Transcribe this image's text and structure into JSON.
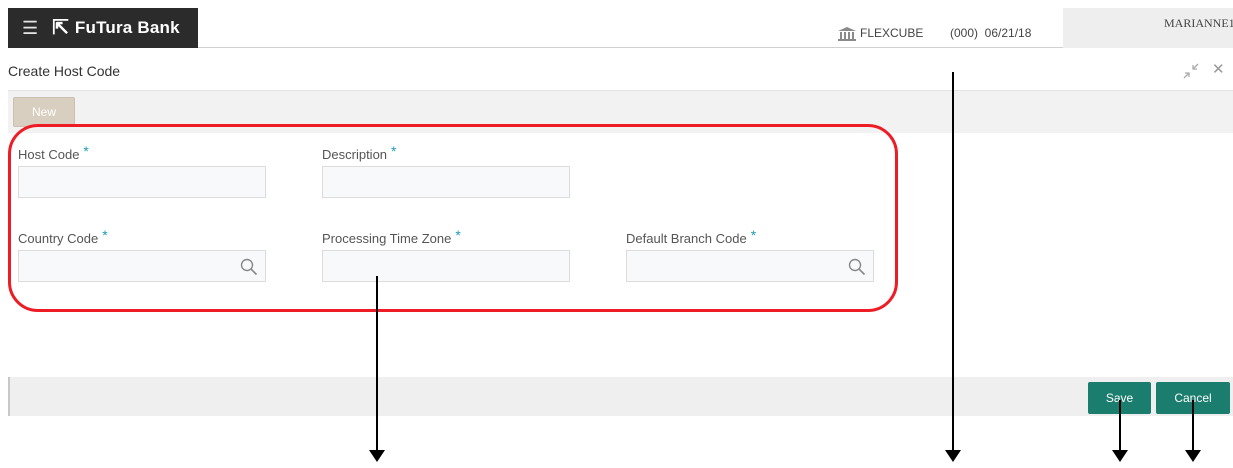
{
  "header": {
    "menu_icon": "hamburger-icon",
    "brand_logo": "bank-logo",
    "brand_name": "FuTura Bank",
    "system_icon": "building-columns-icon",
    "system_label": "FLEXCUBE",
    "branch_date": "(000)  06/21/18",
    "user_name": "MARIANNE1"
  },
  "window": {
    "title": "Create Host Code",
    "minimize_icon": "minimize-arrows-icon",
    "close_icon": "close-icon"
  },
  "toolbar": {
    "new_label": "New"
  },
  "form": {
    "required_marker": "*",
    "host_code": {
      "label": "Host Code",
      "value": ""
    },
    "description": {
      "label": "Description",
      "value": ""
    },
    "country_code": {
      "label": "Country Code",
      "value": "",
      "icon": "search-icon"
    },
    "processing_time_zone": {
      "label": "Processing Time Zone",
      "value": ""
    },
    "default_branch_code": {
      "label": "Default Branch Code",
      "value": "",
      "icon": "search-icon"
    }
  },
  "footer": {
    "save_label": "Save",
    "cancel_label": "Cancel"
  },
  "colors": {
    "primary_button": "#1b7d6d",
    "required_star": "#1f9bb5",
    "annotation_outline": "#ee1c24",
    "brand_bar": "#2b2b2b",
    "new_button": "#d9cfc0"
  }
}
